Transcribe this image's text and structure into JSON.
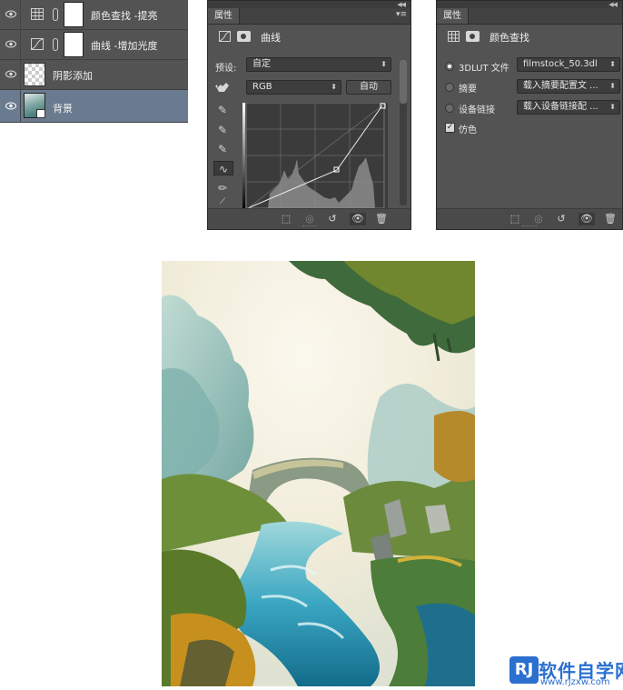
{
  "layers_panel": {
    "layers": [
      {
        "name": "颜色查找 -提亮",
        "type": "color-lookup",
        "has_mask": true,
        "selected": false
      },
      {
        "name": "曲线 -增加光度",
        "type": "curves",
        "has_mask": true,
        "selected": false
      },
      {
        "name": "阴影添加",
        "type": "transparent",
        "has_mask": false,
        "selected": false
      },
      {
        "name": "背景",
        "type": "background",
        "has_mask": false,
        "selected": true
      }
    ]
  },
  "curves_panel": {
    "tab": "属性",
    "title": "曲线",
    "preset_label": "预设:",
    "preset_value": "自定",
    "channel_value": "RGB",
    "auto_button": "自动"
  },
  "lookup_panel": {
    "tab": "属性",
    "title": "颜色查找",
    "options": [
      {
        "label": "3DLUT 文件",
        "value": "filmstock_50.3dl",
        "selected": true
      },
      {
        "label": "摘要",
        "value": "载入摘要配置文 ...",
        "selected": false
      },
      {
        "label": "设备链接",
        "value": "载入设备链接配 ...",
        "selected": false
      }
    ],
    "dither_label": "仿色",
    "dither_checked": true
  },
  "watermark": {
    "icon_text": "RJ",
    "title": "软件自学网",
    "url": "www.rjzxw.com"
  },
  "colors": {
    "panel_bg": "#535353",
    "selected_layer": "#6a7b8f",
    "watermark_blue": "#2b6fcf"
  }
}
